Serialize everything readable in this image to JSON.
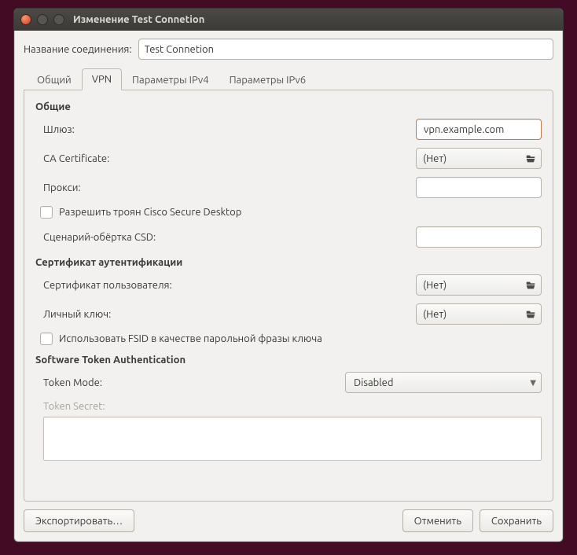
{
  "window": {
    "title": "Изменение Test Connetion"
  },
  "conn_name": {
    "label": "Название соединения:",
    "value": "Test Connetion"
  },
  "tabs": [
    {
      "label": "Общий"
    },
    {
      "label": "VPN"
    },
    {
      "label": "Параметры IPv4"
    },
    {
      "label": "Параметры IPv6"
    }
  ],
  "active_tab": 1,
  "sections": {
    "general": {
      "title": "Общие",
      "gateway_label": "Шлюз:",
      "gateway_value": "vpn.example.com",
      "ca_label": "CA Certificate:",
      "ca_value": "(Нет)",
      "proxy_label": "Прокси:",
      "csd_checkbox": "Разрешить троян Cisco Secure Desktop",
      "csd_wrapper_label": "Сценарий-обёртка CSD:"
    },
    "auth_cert": {
      "title": "Сертификат аутентификации",
      "user_cert_label": "Сертификат пользователя:",
      "user_cert_value": "(Нет)",
      "priv_key_label": "Личный ключ:",
      "priv_key_value": "(Нет)",
      "fsid_checkbox": "Использовать FSID в качестве парольной фразы ключа"
    },
    "token": {
      "title": "Software Token Authentication",
      "mode_label": "Token Mode:",
      "mode_value": "Disabled",
      "secret_label": "Token Secret:"
    }
  },
  "buttons": {
    "export": "Экспортировать…",
    "cancel": "Отменить",
    "save": "Сохранить"
  },
  "icons": {
    "file": "file-open-icon"
  }
}
